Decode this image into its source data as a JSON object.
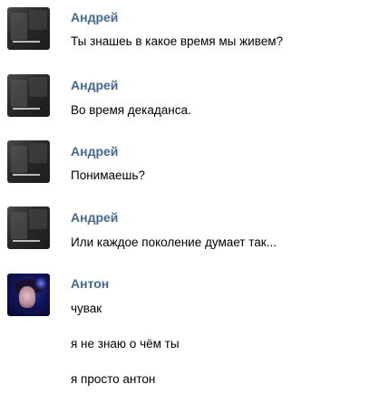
{
  "messages": [
    {
      "author": "Андрей",
      "avatar_icon": "andrey-avatar",
      "lines": [
        "Ты знашеь в какое время мы живем?"
      ]
    },
    {
      "author": "Андрей",
      "avatar_icon": "andrey-avatar",
      "lines": [
        "Во время декаданса."
      ]
    },
    {
      "author": "Андрей",
      "avatar_icon": "andrey-avatar",
      "lines": [
        "Понимаешь?"
      ]
    },
    {
      "author": "Андрей",
      "avatar_icon": "andrey-avatar",
      "lines": [
        "Или каждое поколение думает так..."
      ]
    },
    {
      "author": "Антон",
      "avatar_icon": "anton-avatar",
      "lines": [
        "чувак",
        "я не знаю о чём ты",
        "я просто антон"
      ]
    }
  ],
  "colors": {
    "author_name": "#45688e",
    "message_text": "#000000",
    "background": "#ffffff"
  }
}
